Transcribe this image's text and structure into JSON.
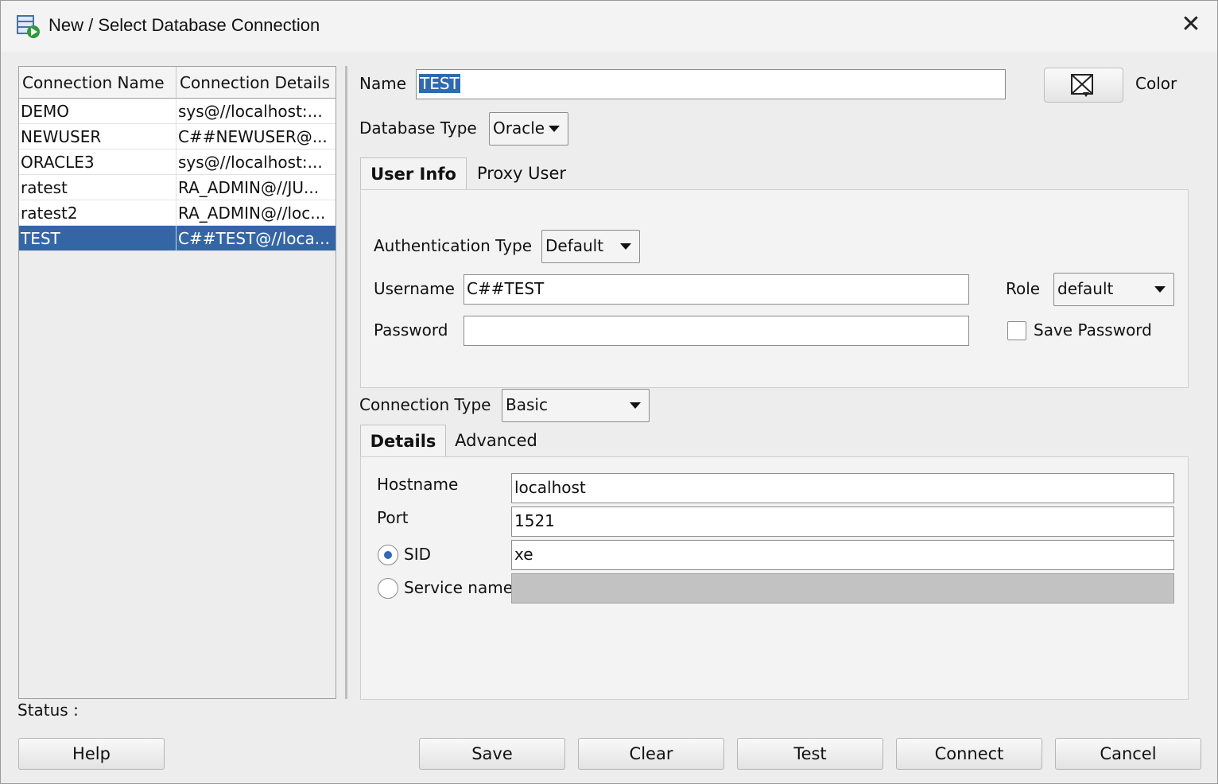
{
  "window": {
    "title": "New / Select Database Connection",
    "close_glyph": "✕"
  },
  "connections": {
    "headers": [
      "Connection Name",
      "Connection Details"
    ],
    "rows": [
      {
        "name": "DEMO",
        "details": "sys@//localhost:..."
      },
      {
        "name": "NEWUSER",
        "details": "C##NEWUSER@..."
      },
      {
        "name": "ORACLE3",
        "details": "sys@//localhost:..."
      },
      {
        "name": "ratest",
        "details": "RA_ADMIN@//JU..."
      },
      {
        "name": "ratest2",
        "details": "RA_ADMIN@//loc..."
      },
      {
        "name": "TEST",
        "details": "C##TEST@//loca..."
      }
    ],
    "selected_index": 5
  },
  "form": {
    "name_label": "Name",
    "name_value": "TEST",
    "color_label": "Color",
    "database_type_label": "Database Type",
    "database_type_value": "Oracle",
    "tabs1": [
      "User Info",
      "Proxy User"
    ],
    "auth_type_label": "Authentication Type",
    "auth_type_value": "Default",
    "username_label": "Username",
    "username_value": "C##TEST",
    "role_label": "Role",
    "role_value": "default",
    "password_label": "Password",
    "password_value": "",
    "save_password_label": "Save Password",
    "connection_type_label": "Connection Type",
    "connection_type_value": "Basic",
    "tabs2": [
      "Details",
      "Advanced"
    ],
    "hostname_label": "Hostname",
    "hostname_value": "localhost",
    "port_label": "Port",
    "port_value": "1521",
    "sid_label": "SID",
    "sid_value": "xe",
    "service_name_label": "Service name",
    "service_name_value": ""
  },
  "status_label": "Status :",
  "buttons": {
    "help": "Help",
    "save": "Save",
    "clear": "Clear",
    "test": "Test",
    "connect": "Connect",
    "cancel": "Cancel"
  },
  "colors": {
    "selection": "#3466a6",
    "window_bg": "#ededed"
  }
}
